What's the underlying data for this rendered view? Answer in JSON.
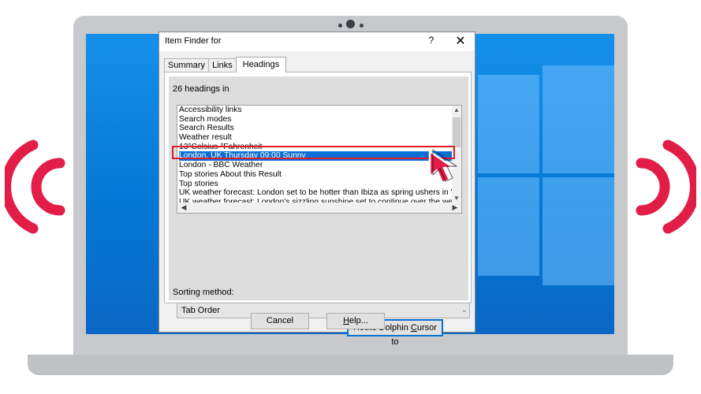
{
  "dialog": {
    "title": "Item Finder for",
    "help_glyph": "?",
    "close_glyph": "✕",
    "tabs": [
      {
        "label": "Summary"
      },
      {
        "label": "Links"
      },
      {
        "label": "Headings"
      }
    ],
    "active_tab": "Headings",
    "heading_count": "26 headings in",
    "list_items": [
      "Accessibility links",
      "Search modes",
      "Search Results",
      "Weather result",
      "13°Celsius °Fahrenheit",
      "London, UK Thursday 09:00 Sunny",
      "London - BBC Weather",
      "Top stories About this Result",
      "Top stories",
      "UK weather forecast: London set to be hotter than Ibiza as spring ushers in 'seven",
      "UK weather forecast: London's sizzling sunshine set to continue over the weekend"
    ],
    "selected_item": "London, UK Thursday 09:00 Sunny",
    "sort_label": "Sorting method:",
    "sort_value": "Tab Order",
    "route_button_pre": "Route Dolphin ",
    "route_button_ul": "C",
    "route_button_post": "ursor to",
    "cancel_label": "Cancel",
    "help_label_ul": "H",
    "help_label_rest": "elp..."
  },
  "colors": {
    "accent": "#0a6fd4",
    "highlight": "#e01b2a",
    "sound_wave": "#e11d48",
    "desktop": "#0a7fd9"
  },
  "icons": {
    "sound_left": "sound-wave-left-icon",
    "sound_right": "sound-wave-right-icon",
    "pointer": "mouse-pointer-icon"
  }
}
